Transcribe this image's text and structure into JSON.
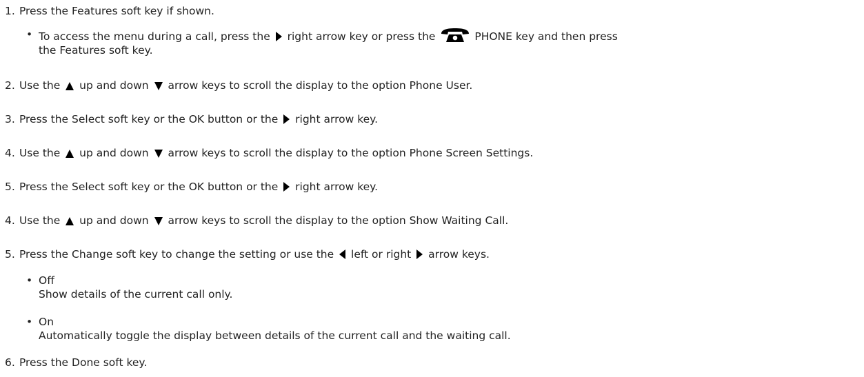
{
  "steps": [
    {
      "num": "1.",
      "parts": [
        "Press the Features soft key if shown."
      ]
    },
    {
      "num": "2.",
      "parts": [
        "Use the ",
        " up and down ",
        " arrow keys to scroll the display to the option Phone User."
      ]
    },
    {
      "num": "3.",
      "parts": [
        "Press the Select soft key or the OK button or the ",
        " right arrow key."
      ]
    },
    {
      "num": "4.",
      "parts": [
        "Use the ",
        " up and down ",
        " arrow keys to scroll the display to the option Phone Screen Settings."
      ]
    },
    {
      "num": "5.",
      "parts": [
        "Press the Select soft key or the OK button or the ",
        " right arrow key."
      ]
    },
    {
      "num": "4.",
      "parts": [
        "Use the ",
        " up and down ",
        " arrow keys to scroll the display to the option Show Waiting Call."
      ]
    },
    {
      "num": "5.",
      "parts": [
        "Press the Change soft key to change the setting or use the ",
        " left or right ",
        " arrow keys."
      ]
    },
    {
      "num": "6.",
      "parts": [
        "Press the Done soft key."
      ]
    }
  ],
  "step1_note": {
    "bullet": "•",
    "line1_parts": [
      "To access the menu during a call, press the ",
      " right arrow key or press the ",
      "PHONE key and then press"
    ],
    "line2": "the Features soft key."
  },
  "options": [
    {
      "bullet": "•",
      "title": "Off",
      "description": "Show details of the current call only."
    },
    {
      "bullet": "•",
      "title": "On",
      "description": "Automatically toggle the display between details of the current call and the waiting call."
    }
  ],
  "icons": {
    "right_arrow": "right-arrow-icon",
    "left_arrow": "left-arrow-icon",
    "up_arrow": "up-arrow-icon",
    "down_arrow": "down-arrow-icon",
    "phone": "phone-icon"
  }
}
